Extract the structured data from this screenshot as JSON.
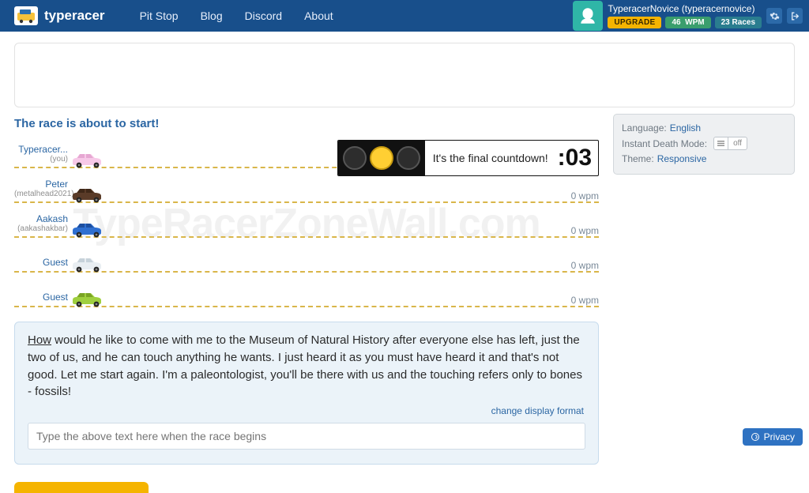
{
  "brand": "typeracer",
  "nav": {
    "links": [
      "Pit Stop",
      "Blog",
      "Discord",
      "About"
    ]
  },
  "user": {
    "display": "TyperacerNovice (typeracernovice)",
    "upgrade": "UPGRADE",
    "wpm_value": "46",
    "wpm_unit": "WPM",
    "races_value": "23",
    "races_unit": "Races"
  },
  "race": {
    "status": "The race is about to start!",
    "countdown_text": "It's the final countdown!",
    "countdown_timer": ":03",
    "lanes": [
      {
        "name": "Typeracer...",
        "sub": "(you)",
        "wpm": "",
        "car": "pink"
      },
      {
        "name": "Peter",
        "sub": "(metalhead2021)",
        "wpm": "0 wpm",
        "car": "brown"
      },
      {
        "name": "Aakash",
        "sub": "(aakashakbar)",
        "wpm": "0 wpm",
        "car": "blue"
      },
      {
        "name": "Guest",
        "sub": "",
        "wpm": "0 wpm",
        "car": "white"
      },
      {
        "name": "Guest",
        "sub": "",
        "wpm": "0 wpm",
        "car": "green"
      }
    ]
  },
  "quote": {
    "first_word": "How",
    "rest": " would he like to come with me to the Museum of Natural History after everyone else has left, just the two of us, and he can touch anything he wants. I just heard it as you must have heard it and that's not good. Let me start again. I'm a paleontologist, you'll be there with us and the touching refers only to bones - fossils!",
    "change_format": "change display format",
    "placeholder": "Type the above text here when the race begins"
  },
  "settings": {
    "language_label": "Language:",
    "language_value": "English",
    "death_label": "Instant Death Mode:",
    "death_state": "off",
    "theme_label": "Theme:",
    "theme_value": "Responsive"
  },
  "privacy": "Privacy",
  "watermark": "TypeRacerZoneWall.com"
}
